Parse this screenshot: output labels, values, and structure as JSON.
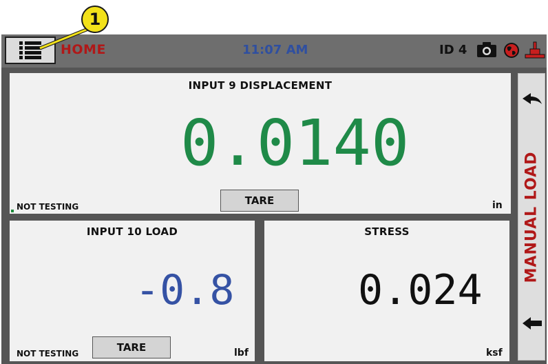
{
  "callout": {
    "number": "1"
  },
  "header": {
    "home_label": "HOME",
    "time": "11:07 AM",
    "id_label": "ID 4",
    "icons": [
      "menu-list-icon",
      "camera-icon",
      "globe-icon",
      "network-icon"
    ]
  },
  "panels": {
    "displacement": {
      "title": "INPUT 9 DISPLACEMENT",
      "value": "0.0140",
      "status": "NOT TESTING",
      "tare_label": "TARE",
      "unit": "in",
      "value_color": "#1f8a48"
    },
    "load": {
      "title": "INPUT 10 LOAD",
      "value": "-0.8",
      "status": "NOT TESTING",
      "tare_label": "TARE",
      "unit": "lbf",
      "value_color": "#3552a4"
    },
    "stress": {
      "title": "STRESS",
      "value": "0.024",
      "unit": "ksf",
      "value_color": "#111111"
    }
  },
  "side": {
    "label": "MANUAL LOAD",
    "label_color": "#b01818"
  }
}
